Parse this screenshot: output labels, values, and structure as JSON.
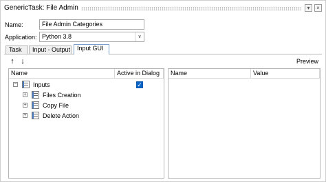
{
  "window": {
    "title": "GenericTask: File Admin",
    "menu_glyph": "▾",
    "close_glyph": "×"
  },
  "form": {
    "name_label": "Name:",
    "name_value": "File Admin Categories",
    "application_label": "Application:",
    "application_value": "Python 3.8",
    "dropdown_glyph": "∨"
  },
  "tabs": [
    {
      "label": "Task"
    },
    {
      "label": "Input - Output"
    },
    {
      "label": "Input GUI",
      "active": true
    }
  ],
  "toolbar": {
    "move_up": "↑",
    "move_down": "↓",
    "preview_label": "Preview"
  },
  "tree": {
    "columns": [
      "Name",
      "Active in Dialog"
    ],
    "rows": [
      {
        "label": "Inputs",
        "expander": "−",
        "active_checked": true
      },
      {
        "label": "Files Creation",
        "expander": "+"
      },
      {
        "label": "Copy File",
        "expander": "+"
      },
      {
        "label": "Delete Action",
        "expander": "+"
      }
    ],
    "check_glyph": "✓"
  },
  "properties": {
    "columns": [
      "Name",
      "Value"
    ]
  }
}
